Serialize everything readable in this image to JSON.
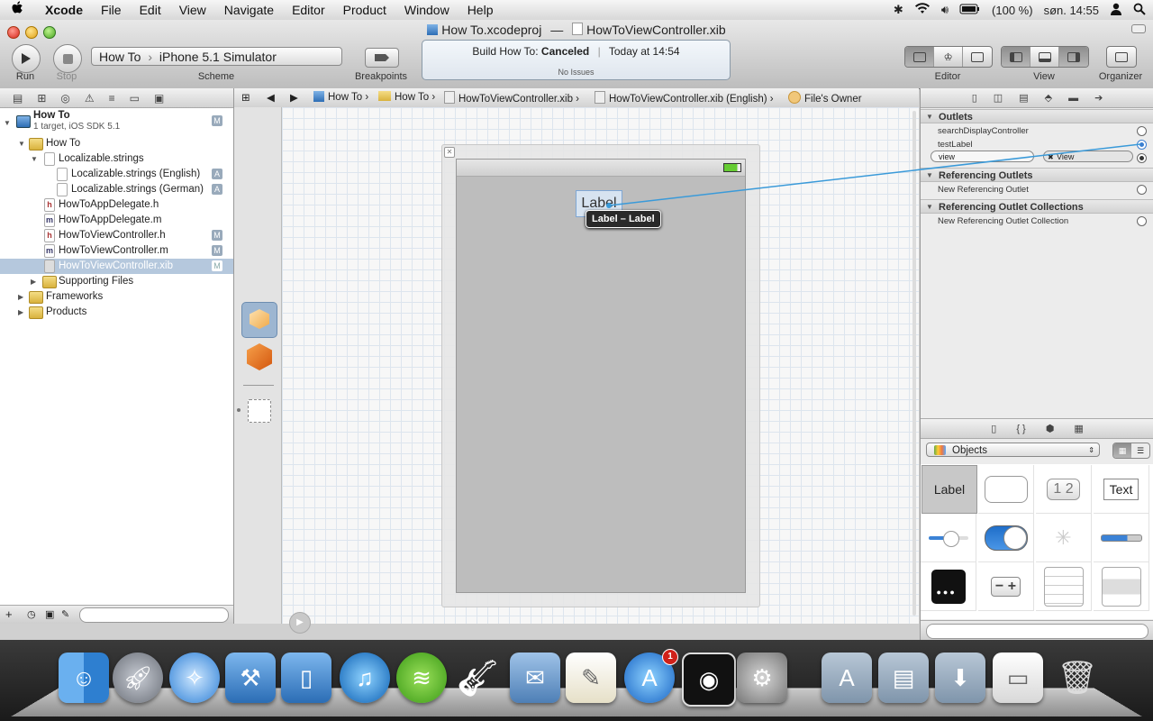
{
  "menubar": {
    "app": "Xcode",
    "items": [
      "File",
      "Edit",
      "View",
      "Navigate",
      "Editor",
      "Product",
      "Window",
      "Help"
    ],
    "battery": "(100 %)",
    "clock": "søn. 14:55"
  },
  "window": {
    "title_project": "How To.xcodeproj",
    "title_sep": "—",
    "title_file": "HowToViewController.xib"
  },
  "toolbar": {
    "run_label": "Run",
    "stop_label": "Stop",
    "scheme_target": "How To",
    "scheme_dest": "iPhone 5.1 Simulator",
    "scheme_label": "Scheme",
    "breakpoints_label": "Breakpoints",
    "status_build": "Build How To:",
    "status_state": "Canceled",
    "status_time": "Today at 14:54",
    "status_issues": "No Issues",
    "editor_label": "Editor",
    "view_label": "View",
    "organizer_label": "Organizer"
  },
  "navigator": {
    "project_name": "How To",
    "project_sub": "1 target, iOS SDK 5.1",
    "project_badge": "M",
    "rows": [
      {
        "label": "How To",
        "kind": "folder",
        "badge": ""
      },
      {
        "label": "Localizable.strings",
        "kind": "file",
        "badge": ""
      },
      {
        "label": "Localizable.strings (English)",
        "kind": "file",
        "badge": "A"
      },
      {
        "label": "Localizable.strings (German)",
        "kind": "file",
        "badge": "A"
      },
      {
        "label": "HowToAppDelegate.h",
        "kind": "h",
        "badge": ""
      },
      {
        "label": "HowToAppDelegate.m",
        "kind": "m",
        "badge": ""
      },
      {
        "label": "HowToViewController.h",
        "kind": "h",
        "badge": "M"
      },
      {
        "label": "HowToViewController.m",
        "kind": "m",
        "badge": "M"
      },
      {
        "label": "HowToViewController.xib",
        "kind": "xib",
        "badge": "M"
      },
      {
        "label": "Supporting Files",
        "kind": "folder",
        "badge": ""
      },
      {
        "label": "Frameworks",
        "kind": "folder",
        "badge": ""
      },
      {
        "label": "Products",
        "kind": "folder",
        "badge": ""
      }
    ]
  },
  "jumpbar": {
    "crumbs": [
      "How To",
      "How To",
      "HowToViewController.xib",
      "HowToViewController.xib (English)",
      "File's Owner"
    ]
  },
  "canvas": {
    "label_text": "Label",
    "tooltip": "Label – Label"
  },
  "inspector": {
    "outlets_header": "Outlets",
    "outlets": [
      "searchDisplayController",
      "testLabel",
      "view"
    ],
    "view_target": "View",
    "ref_outlets_header": "Referencing Outlets",
    "new_ref_outlet": "New Referencing Outlet",
    "ref_collections_header": "Referencing Outlet Collections",
    "new_ref_collection": "New Referencing Outlet Collection"
  },
  "library": {
    "selector": "Objects",
    "cells": [
      "Label",
      "",
      "1 2",
      "Text"
    ]
  },
  "dock": {
    "appstore_badge": "1"
  },
  "colors": {
    "selection": "#b5c8dd",
    "connection_line": "#3a9ad9",
    "canvas_view": "#bdbdbd"
  }
}
